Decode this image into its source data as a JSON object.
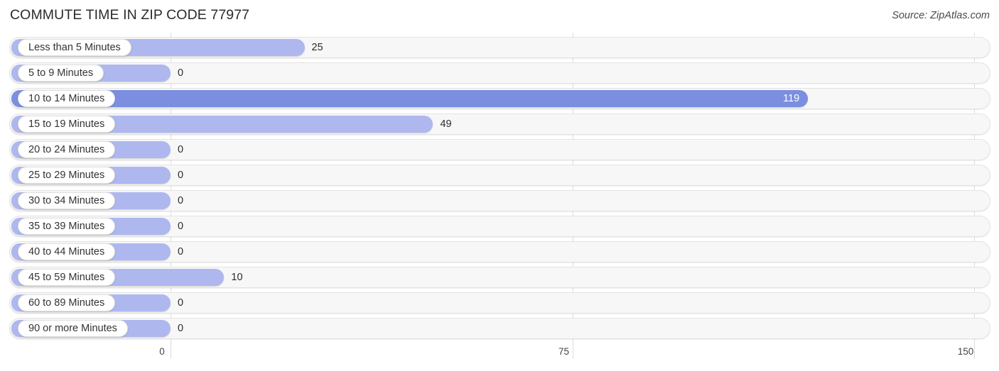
{
  "header": {
    "title": "COMMUTE TIME IN ZIP CODE 77977",
    "source": "Source: ZipAtlas.com"
  },
  "colors": {
    "bar": "#aeb8ee",
    "bar_highlight": "#7b8ee0",
    "track": "#f7f7f7",
    "gridline": "#dcdcdc",
    "label_pill": "#ffffff"
  },
  "chart_data": {
    "type": "bar",
    "orientation": "horizontal",
    "title": "COMMUTE TIME IN ZIP CODE 77977",
    "source": "Source: ZipAtlas.com",
    "xlabel": "",
    "ylabel": "",
    "xlim": [
      0,
      150
    ],
    "ticks": [
      "0",
      "75",
      "150"
    ],
    "tick_values": [
      0,
      75,
      150
    ],
    "grid": true,
    "legend": "none",
    "highlight_category": "10 to 14 Minutes",
    "categories": [
      "Less than 5 Minutes",
      "5 to 9 Minutes",
      "10 to 14 Minutes",
      "15 to 19 Minutes",
      "20 to 24 Minutes",
      "25 to 29 Minutes",
      "30 to 34 Minutes",
      "35 to 39 Minutes",
      "40 to 44 Minutes",
      "45 to 59 Minutes",
      "60 to 89 Minutes",
      "90 or more Minutes"
    ],
    "values": [
      25,
      0,
      119,
      49,
      0,
      0,
      0,
      0,
      0,
      10,
      0,
      0
    ],
    "value_labels": [
      "25",
      "0",
      "119",
      "49",
      "0",
      "0",
      "0",
      "0",
      "0",
      "10",
      "0",
      "0"
    ]
  }
}
